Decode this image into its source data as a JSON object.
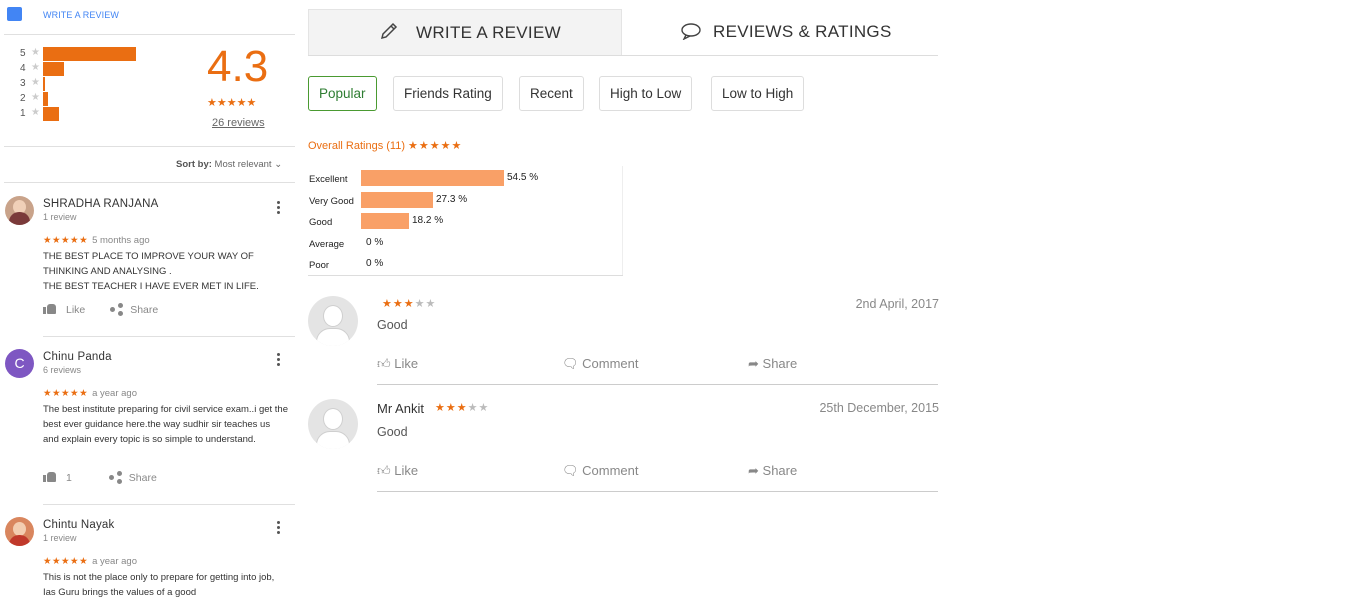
{
  "left": {
    "write_review": "WRITE A REVIEW",
    "distribution": [
      {
        "star": "5",
        "fraction": 0.96
      },
      {
        "star": "4",
        "fraction": 0.22
      },
      {
        "star": "3",
        "fraction": 0.0
      },
      {
        "star": "2",
        "fraction": 0.05
      },
      {
        "star": "1",
        "fraction": 0.17
      }
    ],
    "rating": "4.3",
    "rating_stars": "★★★★★",
    "review_count": "26 reviews",
    "sort_label": "Sort by:",
    "sort_value": "Most relevant",
    "reviews": [
      {
        "name": "SHRADHA RANJANA",
        "count": "1 review",
        "stars": "★★★★★",
        "date": "5 months ago",
        "text": "THE BEST PLACE TO IMPROVE YOUR WAY OF THINKING AND ANALYSING .\nTHE BEST TEACHER I HAVE EVER MET IN LIFE.",
        "like": "Like",
        "share": "Share"
      },
      {
        "name": "Chinu Panda",
        "initial": "C",
        "count": "6 reviews",
        "stars": "★★★★★",
        "date": "a year ago",
        "text": "The best institute  preparing  for civil service exam..i get the best ever guidance here.the way sudhir sir teaches us and explain every topic is so simple to understand.",
        "like": "1",
        "share": "Share"
      },
      {
        "name": "Chintu Nayak",
        "count": "1 review",
        "stars": "★★★★★",
        "date": "a year ago",
        "text": "This is not the place only to prepare for getting into job, Ias Guru brings the values of a good",
        "like": "Like",
        "share": "Share"
      }
    ]
  },
  "right": {
    "tabs": [
      "WRITE A REVIEW",
      "REVIEWS & RATINGS"
    ],
    "filters": [
      "Popular",
      "Friends Rating",
      "Recent",
      "High to Low",
      "Low to High"
    ],
    "overall_label": "Overall Ratings (11)",
    "overall_stars": "★★★★★",
    "reviews": [
      {
        "name": "",
        "stars_on": "★★★",
        "stars_off": "★★",
        "date": "2nd April, 2017",
        "text": "Good",
        "like": "Like",
        "comment": "Comment",
        "share": "Share"
      },
      {
        "name": "Mr Ankit",
        "stars_on": "★★★",
        "stars_off": "★★",
        "date": "25th December, 2015",
        "text": "Good",
        "like": "Like",
        "comment": "Comment",
        "share": "Share"
      }
    ]
  },
  "chart_data": {
    "type": "bar",
    "categories": [
      "Excellent",
      "Very Good",
      "Good",
      "Average",
      "Poor"
    ],
    "values": [
      54.5,
      27.3,
      18.2,
      0,
      0
    ],
    "value_labels": [
      "54.5 %",
      "27.3 %",
      "18.2 %",
      "0 %",
      "0 %"
    ],
    "orientation": "horizontal",
    "xlim": [
      0,
      100
    ],
    "bar_color": "#f9a067"
  },
  "colors": {
    "accent": "#ea6e12",
    "link": "#4285f4",
    "selected": "#4a9a31"
  }
}
